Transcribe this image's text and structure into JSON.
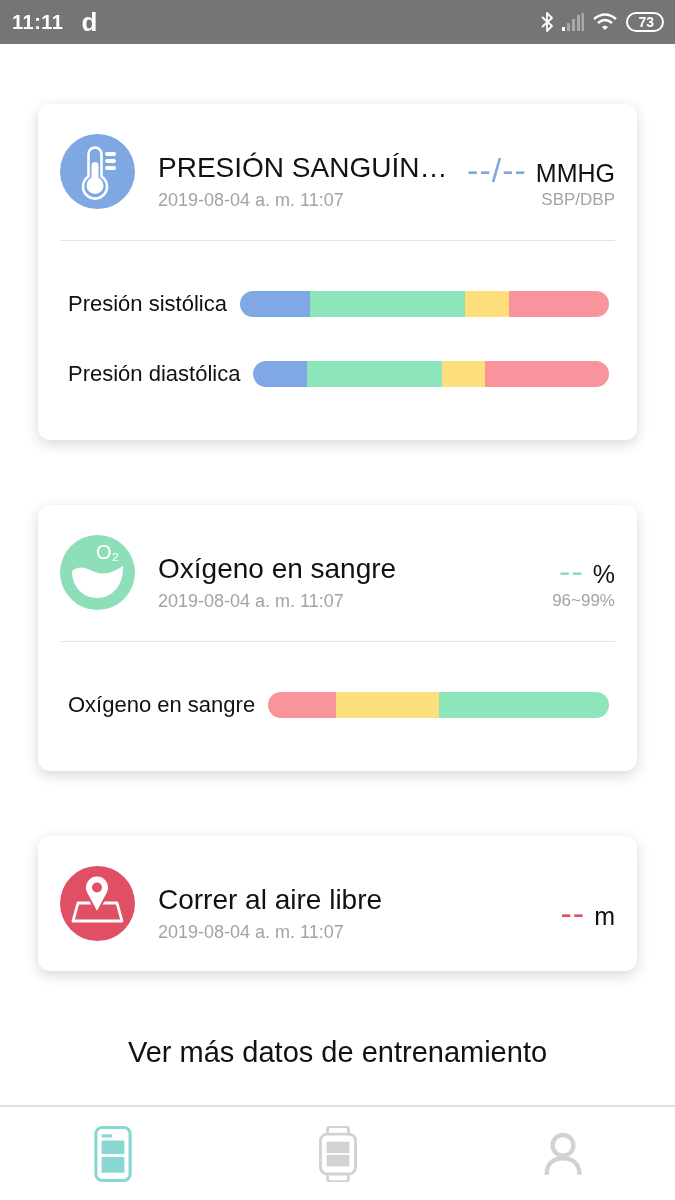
{
  "status_bar": {
    "time": "11:11",
    "app_notification": "d",
    "battery": "73"
  },
  "cards": [
    {
      "kind": "blood_pressure",
      "color": "#7fa8e3",
      "title": "PRESIÓN SANGUÍN…",
      "date": "2019-08-04 a. m. 11:07",
      "value": "--/--",
      "unit": "MMHG",
      "range": "SBP/DBP",
      "bars": [
        {
          "kind": "systolic",
          "label": "Presión sistólica"
        },
        {
          "kind": "diastolic",
          "label": "Presión diastólica"
        }
      ]
    },
    {
      "kind": "oxygen",
      "color": "#8ddfb9",
      "icon_label": "O₂",
      "title": "Oxígeno en sangre",
      "date": "2019-08-04 a. m. 11:07",
      "value": "--",
      "unit": "%",
      "range": "96~99%",
      "bars": [
        {
          "kind": "oxygen",
          "label": "Oxígeno en sangre"
        }
      ]
    },
    {
      "kind": "outdoor_run",
      "color": "#e04f63",
      "title": "Correr al aire libre",
      "date": "2019-08-04 a. m. 11:07",
      "value": "--",
      "unit": "m"
    }
  ],
  "more_link": "Ver más datos de entrenamiento",
  "nav": [
    {
      "kind": "summary",
      "selected": true
    },
    {
      "kind": "device",
      "selected": false
    },
    {
      "kind": "profile",
      "selected": false
    }
  ]
}
